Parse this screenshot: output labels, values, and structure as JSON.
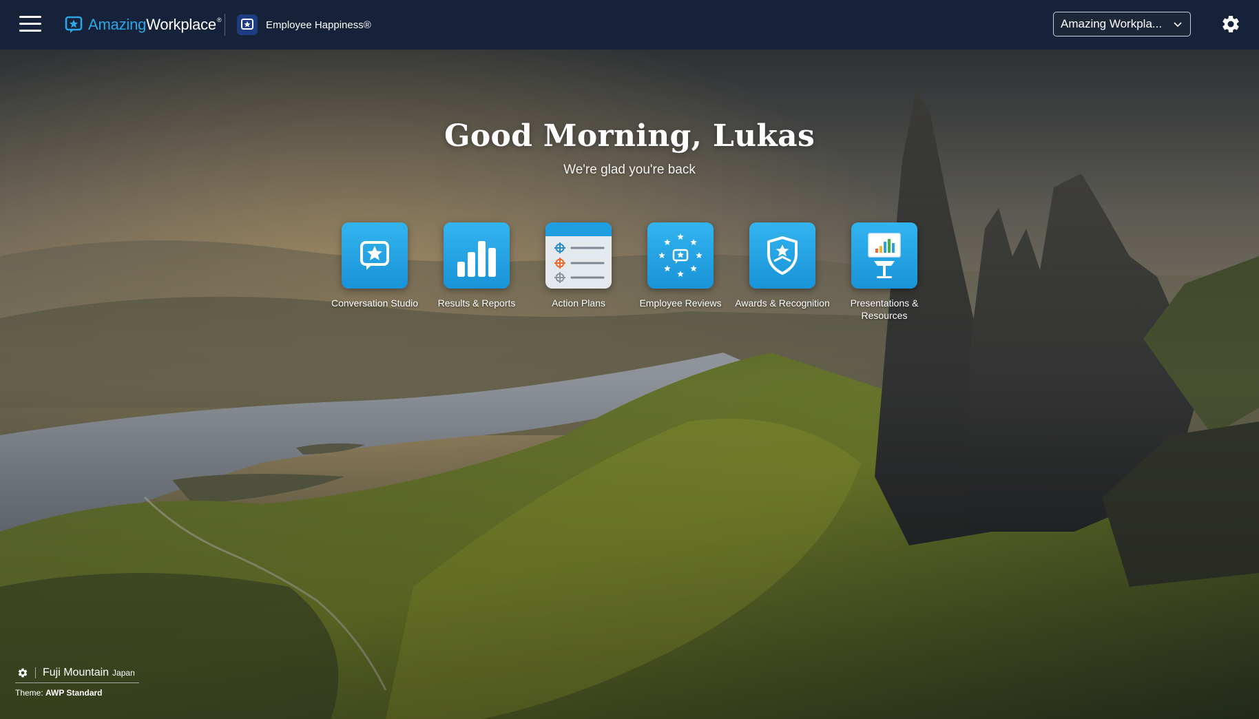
{
  "header": {
    "brand_part1": "Amazing",
    "brand_part2": "Workplace",
    "brand_reg": "®",
    "product_name": "Employee Happiness®",
    "org_select_value": "Amazing Workpla...",
    "menu_icon": "hamburger-menu-icon",
    "settings_icon": "gear-icon"
  },
  "hero": {
    "greeting": "Good Morning, Lukas",
    "subtitle": "We're glad you're back"
  },
  "tiles": [
    {
      "label": "Conversation Studio",
      "icon": "conversation-star-icon"
    },
    {
      "label": "Results & Reports",
      "icon": "bar-chart-icon"
    },
    {
      "label": "Action Plans",
      "icon": "action-plan-list-icon"
    },
    {
      "label": "Employee Reviews",
      "icon": "stars-circle-icon"
    },
    {
      "label": "Awards & Recognition",
      "icon": "shield-star-icon"
    },
    {
      "label": "Presentations & Resources",
      "icon": "presentation-board-icon"
    }
  ],
  "theme": {
    "location": "Fuji Mountain",
    "country": "Japan",
    "label": "Theme:",
    "name": "AWP Standard"
  },
  "colors": {
    "topbar": "#16213a",
    "accent": "#2aa7e6",
    "tile": "#1f9fe2"
  }
}
